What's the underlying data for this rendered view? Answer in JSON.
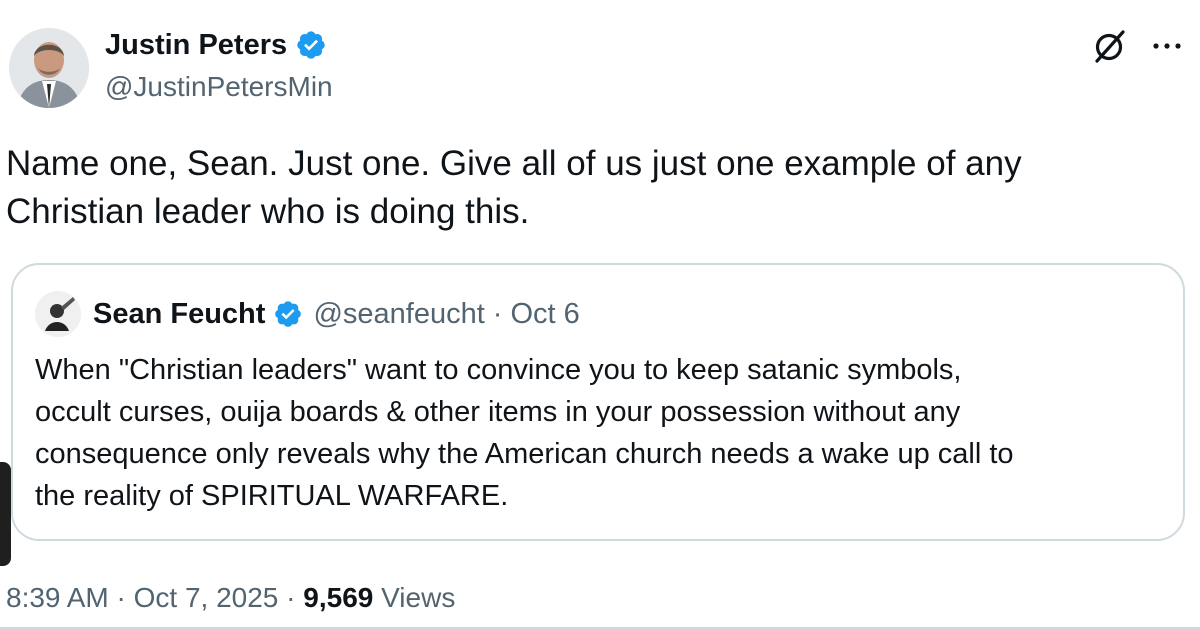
{
  "author": {
    "name": "Justin Peters",
    "handle": "@JustinPetersMin"
  },
  "tweet": {
    "text": "Name one, Sean. Just one. Give all of us just one example of any\nChristian leader who is doing this."
  },
  "quoted": {
    "name": "Sean Feucht",
    "handle": "@seanfeucht",
    "separator": "·",
    "date": "Oct 6",
    "text": "When \"Christian leaders\" want to convince you to keep satanic symbols,\noccult curses, ouija boards & other items in your possession without any\nconsequence only reveals why the American church needs a wake up call to\nthe reality of SPIRITUAL WARFARE."
  },
  "meta": {
    "time": "8:39 AM",
    "separator": "·",
    "date": "Oct 7, 2025",
    "views_count": "9,569",
    "views_label": "Views"
  },
  "icons": {
    "verified": "verified-badge-icon",
    "grok": "grok-icon",
    "more": "more-icon"
  },
  "colors": {
    "verified_blue": "#1d9bf0",
    "secondary_text": "#536471",
    "border": "#cfd9de"
  }
}
